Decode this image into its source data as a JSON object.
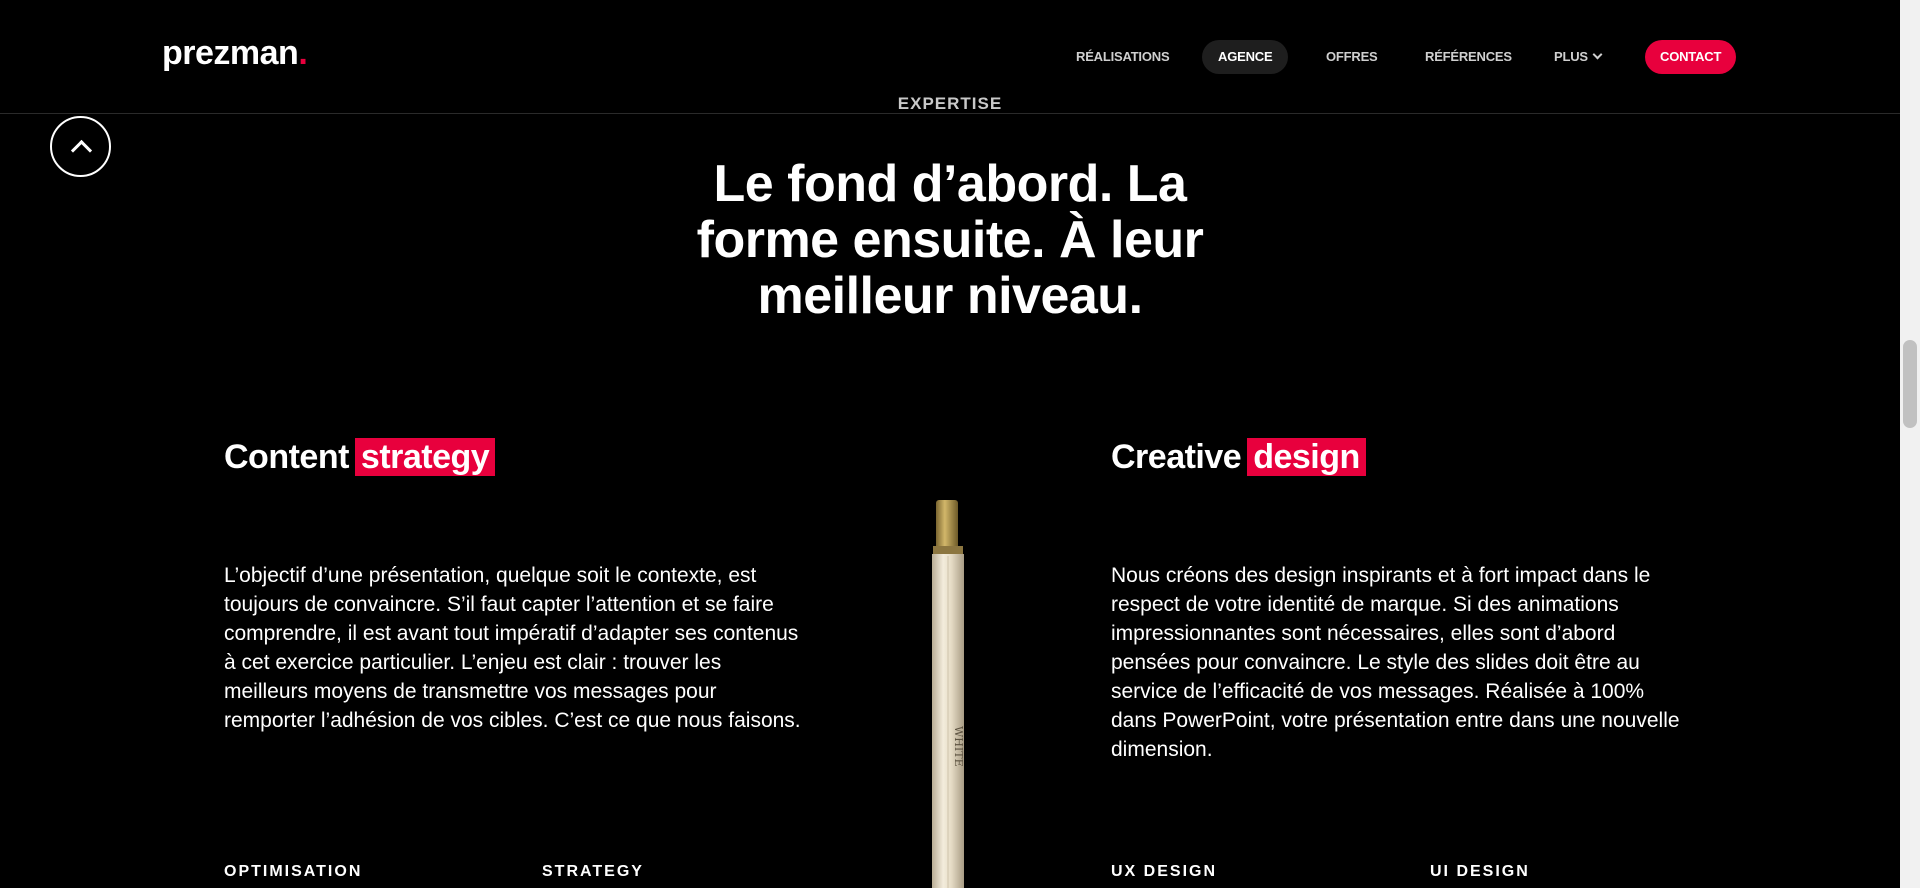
{
  "header": {
    "logo_text": "prezman",
    "logo_dot": ".",
    "nav": [
      {
        "label": "RÉALISATIONS"
      },
      {
        "label": "AGENCE"
      },
      {
        "label": "OFFRES"
      },
      {
        "label": "RÉFÉRENCES"
      },
      {
        "label": "PLUS"
      },
      {
        "label": "CONTACT"
      }
    ]
  },
  "section": {
    "eyebrow": "EXPERTISE",
    "headline_lines": [
      "Le fond d’abord. La",
      "forme ensuite. À leur",
      "meilleur niveau."
    ]
  },
  "left": {
    "title": "Content",
    "title_highlight": "strategy",
    "text": "L’objectif d’une présentation, quelque soit le contexte, est toujours de convaincre. S’il faut capter l’attention et se faire comprendre, il est avant tout impératif d’adapter ses contenus à cet exercice particulier. L’enjeu est clair : trouver les meilleurs moyens de transmettre vos messages pour remporter l’adhésion de vos cibles. C’est ce que nous faisons.",
    "sub_items": [
      "OPTIMISATION",
      "STRATEGY"
    ]
  },
  "right": {
    "title": "Creative",
    "title_highlight": "design",
    "text": "Nous créons des design inspirants et à fort impact dans le respect de votre identité de marque. Si des animations impressionnantes sont nécessaires, elles sont d’abord pensées pour convaincre. Le style des slides doit être au service de l’efficacité de vos messages. Réalisée à 100% dans PowerPoint, votre présentation entre dans une nouvelle dimension.",
    "sub_items": [
      "UX DESIGN",
      "UI DESIGN"
    ]
  },
  "pencil_label": "WHITE",
  "colors": {
    "accent": "#e8003d",
    "background": "#000000"
  }
}
